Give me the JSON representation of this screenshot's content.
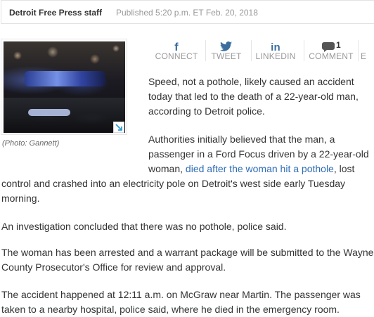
{
  "byline": {
    "author": "Detroit Free Press staff",
    "published": "Published 5:20 p.m. ET Feb. 20, 2018"
  },
  "photo": {
    "caption": "(Photo: Gannett)",
    "expand_icon": "expand-arrow-icon"
  },
  "share": {
    "connect": "CONNECT",
    "tweet": "TWEET",
    "linkedin": "LINKEDIN",
    "comment": "COMMENT",
    "comment_count": "1",
    "email_partial": "E",
    "icons": [
      "facebook-icon",
      "twitter-icon",
      "linkedin-icon",
      "comment-icon"
    ],
    "icon_color": "#3b6e9e"
  },
  "article": {
    "p1": [
      "Speed, not a pothole, likely caused an accident",
      "today that led to the death of a 22-year-old man,",
      "according to Detroit police."
    ],
    "p2_before_link": [
      "Authorities initially believed that the man, a",
      "passenger in a Ford Focus driven by a 22-year-old",
      "woman, "
    ],
    "p2_link": "died after the woman hit a pothole",
    "p2_after_link": [
      ", lost",
      "control and crashed into an electricity pole on Detroit's west side early Tuesday",
      "morning."
    ],
    "p3": "An investigation concluded that there was no pothole, police said.",
    "p4": [
      "The woman has been arrested and a warrant package will be submitted to the Wayne",
      "County Prosecutor's Office for review and approval."
    ],
    "p5": [
      "The accident happened at 12:11 a.m. on McGraw near Martin. The passenger was",
      "taken to a nearby hospital, police said, where he died in the emergency room."
    ],
    "link_color": "#2f6db5"
  }
}
